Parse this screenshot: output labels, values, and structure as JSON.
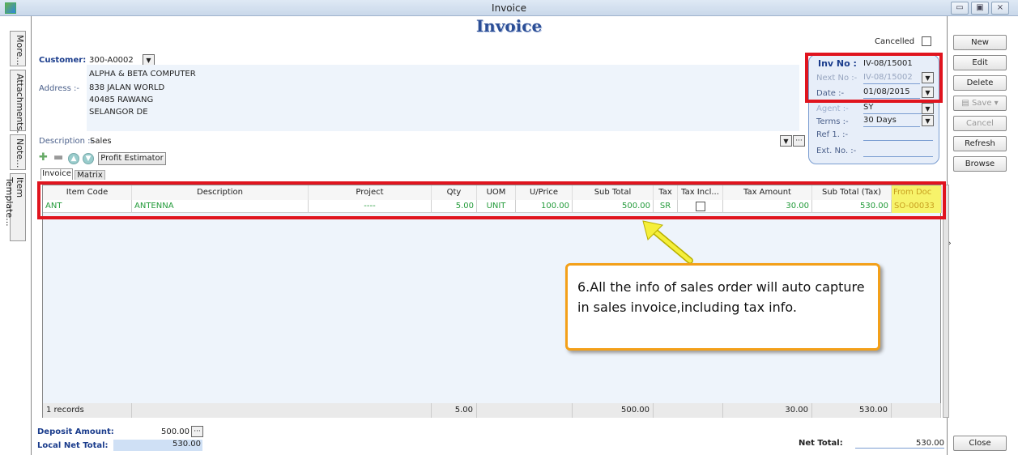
{
  "window": {
    "title": "Invoice",
    "btn_min": "▭",
    "btn_max": "▣",
    "btn_close": "⨯"
  },
  "side_tabs": [
    "More...",
    "Attachments...",
    "Note...",
    "Item Template..."
  ],
  "heading": "Invoice",
  "customer": {
    "label": "Customer:",
    "code": "300-A0002",
    "name": "ALPHA & BETA COMPUTER"
  },
  "address": {
    "label": "Address :-",
    "lines": [
      "838 JALAN WORLD",
      "40485 RAWANG",
      "SELANGOR DE"
    ]
  },
  "description": {
    "label": "Description :-",
    "value": "Sales"
  },
  "cancelled": {
    "label": "Cancelled",
    "checked": false
  },
  "inv": {
    "inv_no_label": "Inv No :",
    "inv_no": "IV-08/15001",
    "next_no_label": "Next No :-",
    "next_no": "IV-08/15002",
    "date_label": "Date :-",
    "date": "01/08/2015",
    "agent_label": "Agent :-",
    "agent": "SY",
    "terms_label": "Terms :-",
    "terms": "30 Days",
    "ref1_label": "Ref 1. :-",
    "ref1": "",
    "extno_label": "Ext. No. :-",
    "extno": ""
  },
  "toolbar": {
    "profit_estimator": "Profit Estimator",
    "ellipsis": "···"
  },
  "tabs": [
    "Invoice",
    "Matrix"
  ],
  "grid": {
    "columns": [
      "Item Code",
      "Description",
      "Project",
      "Qty",
      "UOM",
      "U/Price",
      "Sub Total",
      "Tax",
      "Tax Incl...",
      "Tax Amount",
      "Sub Total (Tax)",
      "From Doc No"
    ],
    "rows": [
      {
        "item_code": "ANT",
        "description": "ANTENNA",
        "project": "----",
        "qty": "5.00",
        "uom": "UNIT",
        "uprice": "100.00",
        "subtotal": "500.00",
        "tax": "SR",
        "tax_incl": false,
        "tax_amount": "30.00",
        "subtotal_tax": "530.00",
        "from_doc": "SO-00033"
      }
    ],
    "footer": {
      "records": "1 records",
      "qty": "5.00",
      "subtotal": "500.00",
      "tax_amount": "30.00",
      "subtotal_tax": "530.00"
    }
  },
  "deposit": {
    "label": "Deposit Amount:",
    "value": "500.00"
  },
  "local_net": {
    "label": "Local Net Total:",
    "value": "530.00"
  },
  "net_total": {
    "label": "Net Total:",
    "value": "530.00"
  },
  "buttons": {
    "new": "New",
    "edit": "Edit",
    "delete": "Delete",
    "save": "Save",
    "cancel": "Cancel",
    "refresh": "Refresh",
    "browse": "Browse",
    "close": "Close"
  },
  "callout": "6.All the info of sales order will auto capture in sales invoice,including tax info.",
  "colors": {
    "highlight": "#e0141e",
    "callout_border": "#f3a019",
    "arrow": "#f5ef3a",
    "grid_text": "#239b3a"
  }
}
